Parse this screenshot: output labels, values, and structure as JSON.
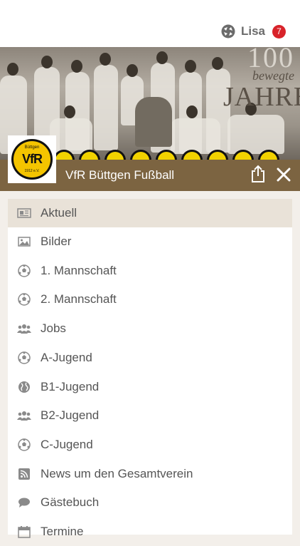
{
  "header": {
    "user_name": "Lisa",
    "notification_count": "7",
    "icon": "user-switch-icon"
  },
  "hero": {
    "line1": "100",
    "line2": "bewegte",
    "line3": "JAHRE"
  },
  "logo": {
    "top_text": "Büttgen",
    "main_text": "VfR",
    "bottom_text": "1912 e.V."
  },
  "club": {
    "name": "VfR Büttgen Fußball",
    "accent": "#7c6441"
  },
  "menu": {
    "items": [
      {
        "label": "Aktuell",
        "icon": "newspaper-icon"
      },
      {
        "label": "Bilder",
        "icon": "image-icon"
      },
      {
        "label": "1. Mannschaft",
        "icon": "soccer-ball-icon"
      },
      {
        "label": "2. Mannschaft",
        "icon": "soccer-ball-icon"
      },
      {
        "label": "Jobs",
        "icon": "users-icon"
      },
      {
        "label": "A-Jugend",
        "icon": "soccer-ball-icon"
      },
      {
        "label": "B1-Jugend",
        "icon": "globe-icon"
      },
      {
        "label": "B2-Jugend",
        "icon": "users-icon"
      },
      {
        "label": "C-Jugend",
        "icon": "soccer-ball-icon"
      },
      {
        "label": "News um den Gesamtverein",
        "icon": "rss-icon"
      },
      {
        "label": "Gästebuch",
        "icon": "chat-bubble-icon"
      },
      {
        "label": "Termine",
        "icon": "calendar-icon"
      }
    ]
  }
}
